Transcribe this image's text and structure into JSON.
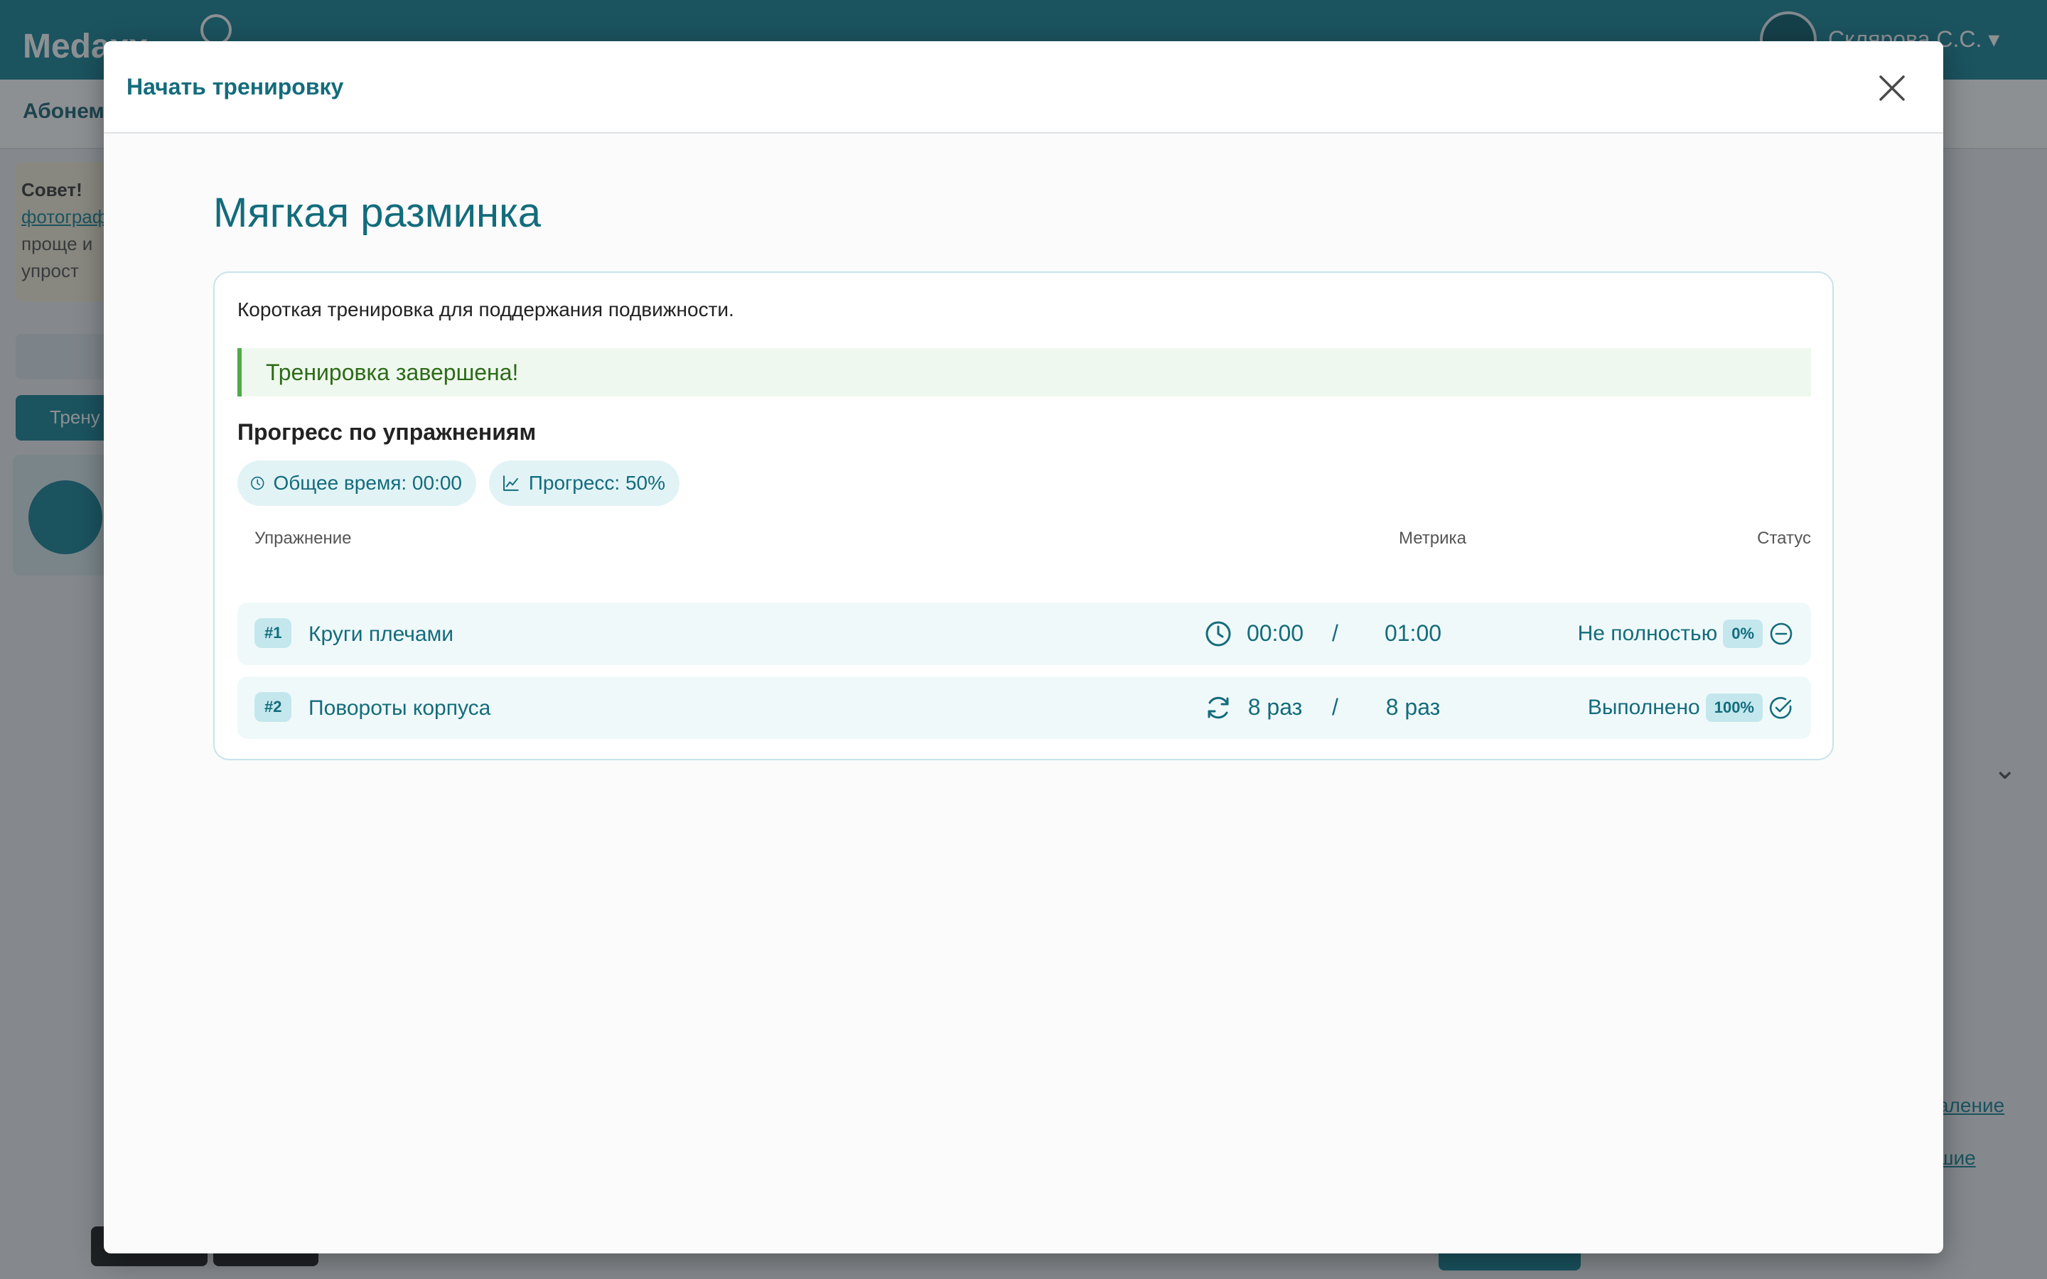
{
  "background_app": {
    "logo": "Medaxx",
    "user_name": "Склярова С.С. ▾",
    "subbar_label": "Абонемент",
    "tip_title": "Совет!",
    "tip_link": "фотограф",
    "tip_line1": "проще и",
    "tip_line2": "упрост",
    "button_label": "Трену",
    "right_chevron": "⌄",
    "right_link1": "аление",
    "right_link2": "шие"
  },
  "modal": {
    "title": "Начать тренировку",
    "close_icon": "close-icon"
  },
  "workout": {
    "title": "Мягкая разминка",
    "description": "Короткая тренировка для поддержания подвижности.",
    "alert": "Тренировка завершена!",
    "progress_heading": "Прогресс по упражнениям",
    "total_time_chip": "Общее время: 00:00",
    "progress_chip": "Прогресс: 50%",
    "progress_value": 0.5,
    "columns": {
      "exercise": "Упражнение",
      "metric": "Метрика",
      "status": "Статус"
    },
    "exercises": [
      {
        "badge": "#1",
        "name": "Круги плечами",
        "metric_icon": "clock-icon",
        "done": "00:00",
        "separator": "/",
        "target": "01:00",
        "status": "Не полностью",
        "percent": "0%",
        "status_icon": "minus-circle-icon"
      },
      {
        "badge": "#2",
        "name": "Повороты корпуса",
        "metric_icon": "repeat-icon",
        "done": "8 раз",
        "separator": "/",
        "target": "8 раз",
        "status": "Выполнено",
        "percent": "100%",
        "status_icon": "check-circle-icon"
      }
    ]
  },
  "colors": {
    "accent": "#136c7c",
    "header_bg": "#1b8496",
    "chip_bg": "#e2f3f6",
    "row_bg": "#f0f9fa",
    "success_border": "#4faa4a",
    "success_text": "#2d6b18"
  }
}
